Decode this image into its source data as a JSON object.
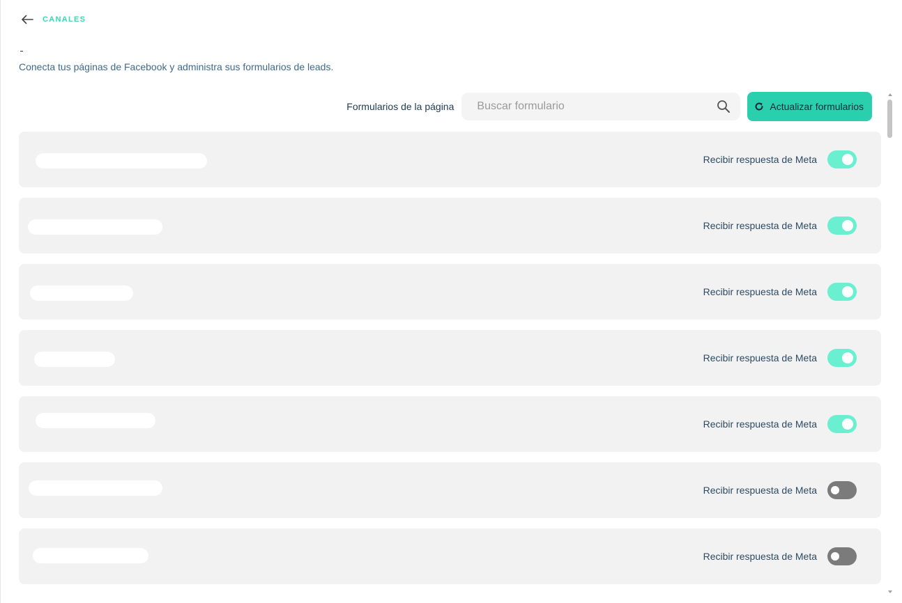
{
  "breadcrumb": {
    "label": "CANALES"
  },
  "header": {
    "subtitle": "Conecta tus páginas de Facebook y administra sus formularios de leads."
  },
  "toolbar": {
    "label": "Formularios de la página",
    "search_placeholder": "Buscar formulario",
    "refresh_label": "Actualizar formularios"
  },
  "forms": [
    {
      "toggle_label": "Recibir respuesta de Meta",
      "enabled": true
    },
    {
      "toggle_label": "Recibir respuesta de Meta",
      "enabled": true
    },
    {
      "toggle_label": "Recibir respuesta de Meta",
      "enabled": true
    },
    {
      "toggle_label": "Recibir respuesta de Meta",
      "enabled": true
    },
    {
      "toggle_label": "Recibir respuesta de Meta",
      "enabled": true
    },
    {
      "toggle_label": "Recibir respuesta de Meta",
      "enabled": false
    },
    {
      "toggle_label": "Recibir respuesta de Meta",
      "enabled": false
    }
  ],
  "colors": {
    "accent": "#2ad0ae",
    "toggle_on": "#6af0d1",
    "toggle_off": "#7b7b7b",
    "breadcrumb": "#3cd6b4"
  }
}
